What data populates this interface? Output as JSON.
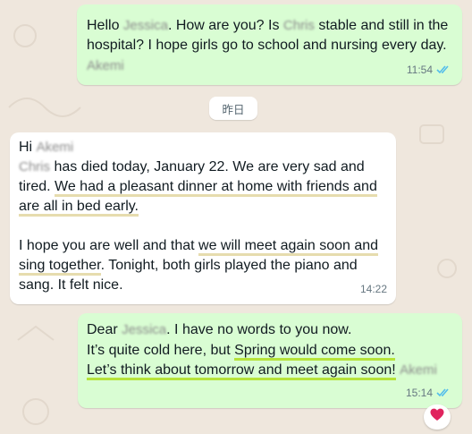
{
  "date_separator": "昨日",
  "messages": [
    {
      "direction": "outgoing",
      "lines": [
        [
          "Hello ",
          "Jessica",
          ". How are you? Is ",
          "Chris",
          " stable and still in the"
        ],
        [
          "hospital? I hope girls go to school and nursing every day."
        ],
        [
          "Akemi"
        ]
      ],
      "time": "11:54",
      "status": "read"
    },
    {
      "direction": "incoming",
      "lines": [
        [
          "Hi ",
          "Akemi"
        ],
        [
          "Chris",
          " has died today, January 22. We are very sad and"
        ],
        [
          "tired. ",
          "We had a pleasant dinner at home with friends and"
        ],
        [
          "are all in bed early."
        ],
        [
          ""
        ],
        [
          "I hope you are well and that ",
          "we will meet again soon and"
        ],
        [
          "sing together",
          ". Tonight, both girls played the piano and"
        ],
        [
          "sang. It felt nice."
        ]
      ],
      "time": "14:22"
    },
    {
      "direction": "outgoing",
      "lines": [
        [
          "Dear ",
          "Jessica",
          ". I have no words to you now."
        ],
        [
          "It’s quite cold here, but ",
          "Spring would come soon."
        ],
        [
          "Let’s think about tomorrow and meet again soon!",
          " ",
          "Akemi"
        ]
      ],
      "time": "15:14",
      "status": "read",
      "reaction": "red-heart"
    }
  ],
  "colors": {
    "background": "#efe7dd",
    "outgoing_bubble": "#d9fdd3",
    "incoming_bubble": "#ffffff",
    "read_ticks": "#53bdeb",
    "highlight_tan": "#e6dcae",
    "highlight_green": "#b6e33a"
  },
  "icons": [
    "double-check-icon",
    "heart-icon"
  ]
}
